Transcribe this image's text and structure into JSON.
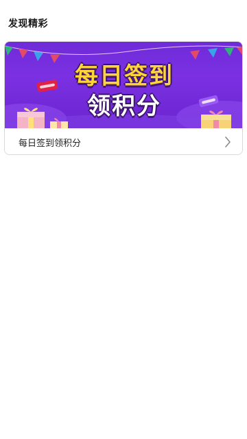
{
  "section": {
    "title": "发现精彩"
  },
  "card": {
    "banner": {
      "line1": "每日签到",
      "line2": "领积分",
      "icons": [
        "pennant-bunting",
        "gift-box",
        "coupon-tag"
      ],
      "colors": {
        "background": "#7b31e2",
        "title_yellow": "#ffd43a",
        "title_white": "#ffffff"
      }
    },
    "label": "每日签到领积分",
    "chevron_icon": "chevron-right-icon"
  }
}
